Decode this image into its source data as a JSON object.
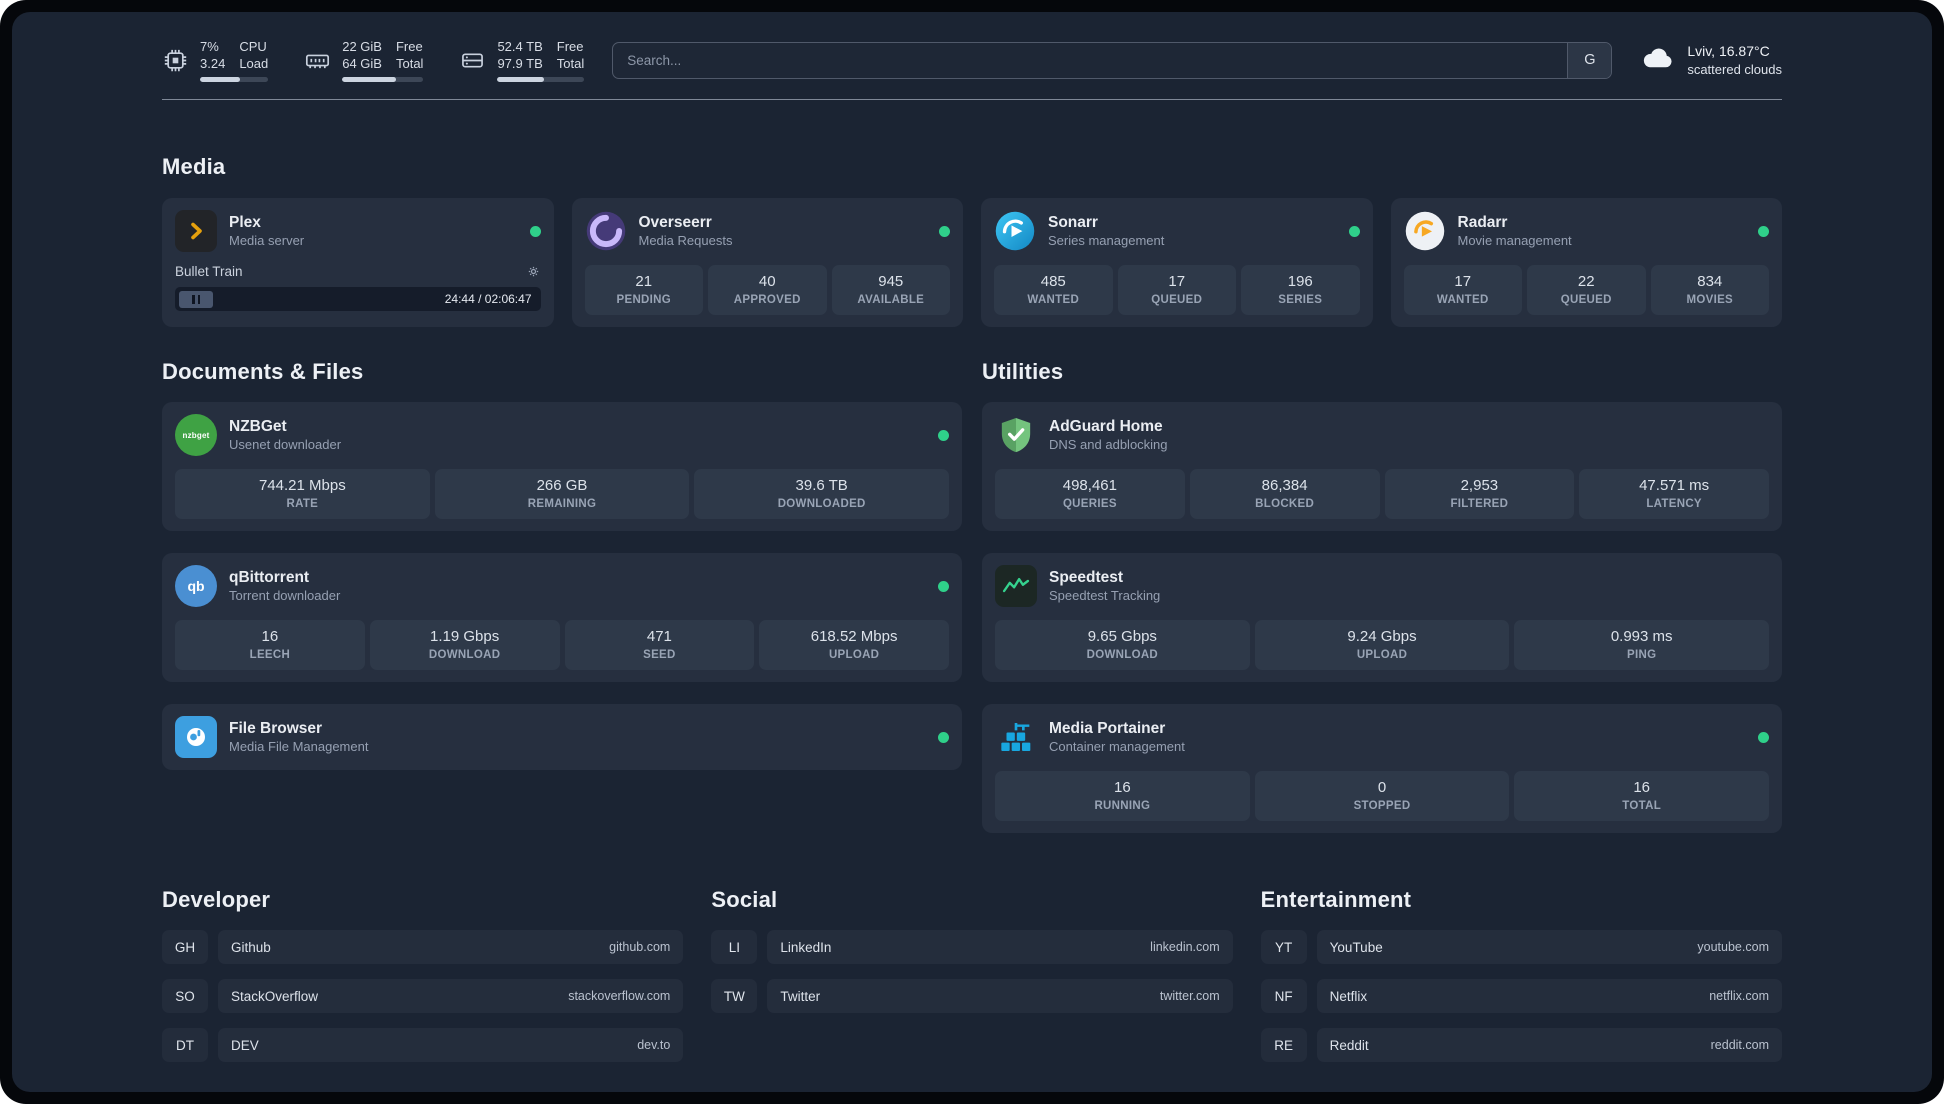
{
  "colors": {
    "background": "#1b2433",
    "card": "#262f3f",
    "stat_tile": "#2e3949",
    "status_green": "#2fd08a",
    "plex_amber": "#e5a00d",
    "portainer_blue": "#18a7e0"
  },
  "topbar": {
    "cpu": {
      "icon": "cpu-chip-icon",
      "value_top": "7%",
      "value_bottom": "3.24",
      "label_top": "CPU",
      "label_bottom": "Load",
      "bar_pct": 58
    },
    "memory": {
      "icon": "memory-icon",
      "value_top": "22 GiB",
      "value_bottom": "64 GiB",
      "label_top": "Free",
      "label_bottom": "Total",
      "bar_pct": 66
    },
    "disk": {
      "icon": "disk-icon",
      "value_top": "52.4 TB",
      "value_bottom": "97.9 TB",
      "label_top": "Free",
      "label_bottom": "Total",
      "bar_pct": 54
    },
    "search": {
      "placeholder": "Search...",
      "provider_label": "G"
    },
    "weather": {
      "icon": "cloud-icon",
      "location": "Lviv, 16.87°C",
      "condition": "scattered clouds"
    }
  },
  "media": {
    "title": "Media",
    "plex": {
      "name": "Plex",
      "desc": "Media server",
      "status": "online",
      "now_playing": "Bullet Train",
      "time": "24:44 / 02:06:47"
    },
    "overseerr": {
      "name": "Overseerr",
      "desc": "Media Requests",
      "status": "online",
      "stats": [
        {
          "value": "21",
          "label": "PENDING"
        },
        {
          "value": "40",
          "label": "APPROVED"
        },
        {
          "value": "945",
          "label": "AVAILABLE"
        }
      ]
    },
    "sonarr": {
      "name": "Sonarr",
      "desc": "Series management",
      "status": "online",
      "stats": [
        {
          "value": "485",
          "label": "WANTED"
        },
        {
          "value": "17",
          "label": "QUEUED"
        },
        {
          "value": "196",
          "label": "SERIES"
        }
      ]
    },
    "radarr": {
      "name": "Radarr",
      "desc": "Movie management",
      "status": "online",
      "stats": [
        {
          "value": "17",
          "label": "WANTED"
        },
        {
          "value": "22",
          "label": "QUEUED"
        },
        {
          "value": "834",
          "label": "MOVIES"
        }
      ]
    }
  },
  "documents": {
    "title": "Documents & Files",
    "nzbget": {
      "name": "NZBGet",
      "desc": "Usenet downloader",
      "status": "online",
      "icon_text": "nzbget",
      "stats": [
        {
          "value": "744.21 Mbps",
          "label": "RATE"
        },
        {
          "value": "266 GB",
          "label": "REMAINING"
        },
        {
          "value": "39.6 TB",
          "label": "DOWNLOADED"
        }
      ]
    },
    "qbittorrent": {
      "name": "qBittorrent",
      "desc": "Torrent downloader",
      "status": "online",
      "icon_text": "qb",
      "stats": [
        {
          "value": "16",
          "label": "LEECH"
        },
        {
          "value": "1.19 Gbps",
          "label": "DOWNLOAD"
        },
        {
          "value": "471",
          "label": "SEED"
        },
        {
          "value": "618.52 Mbps",
          "label": "UPLOAD"
        }
      ]
    },
    "filebrowser": {
      "name": "File Browser",
      "desc": "Media File Management",
      "status": "online"
    }
  },
  "utilities": {
    "title": "Utilities",
    "adguard": {
      "name": "AdGuard Home",
      "desc": "DNS and adblocking",
      "stats": [
        {
          "value": "498,461",
          "label": "QUERIES"
        },
        {
          "value": "86,384",
          "label": "BLOCKED"
        },
        {
          "value": "2,953",
          "label": "FILTERED"
        },
        {
          "value": "47.571 ms",
          "label": "LATENCY"
        }
      ]
    },
    "speedtest": {
      "name": "Speedtest",
      "desc": "Speedtest Tracking",
      "stats": [
        {
          "value": "9.65 Gbps",
          "label": "DOWNLOAD"
        },
        {
          "value": "9.24 Gbps",
          "label": "UPLOAD"
        },
        {
          "value": "0.993 ms",
          "label": "PING"
        }
      ]
    },
    "portainer": {
      "name": "Media Portainer",
      "desc": "Container management",
      "status": "online",
      "stats": [
        {
          "value": "16",
          "label": "RUNNING"
        },
        {
          "value": "0",
          "label": "STOPPED"
        },
        {
          "value": "16",
          "label": "TOTAL"
        }
      ]
    }
  },
  "bookmarks": {
    "developer": {
      "title": "Developer",
      "items": [
        {
          "abbr": "GH",
          "name": "Github",
          "url": "github.com"
        },
        {
          "abbr": "SO",
          "name": "StackOverflow",
          "url": "stackoverflow.com"
        },
        {
          "abbr": "DT",
          "name": "DEV",
          "url": "dev.to"
        }
      ]
    },
    "social": {
      "title": "Social",
      "items": [
        {
          "abbr": "LI",
          "name": "LinkedIn",
          "url": "linkedin.com"
        },
        {
          "abbr": "TW",
          "name": "Twitter",
          "url": "twitter.com"
        }
      ]
    },
    "entertainment": {
      "title": "Entertainment",
      "items": [
        {
          "abbr": "YT",
          "name": "YouTube",
          "url": "youtube.com"
        },
        {
          "abbr": "NF",
          "name": "Netflix",
          "url": "netflix.com"
        },
        {
          "abbr": "RE",
          "name": "Reddit",
          "url": "reddit.com"
        }
      ]
    }
  }
}
